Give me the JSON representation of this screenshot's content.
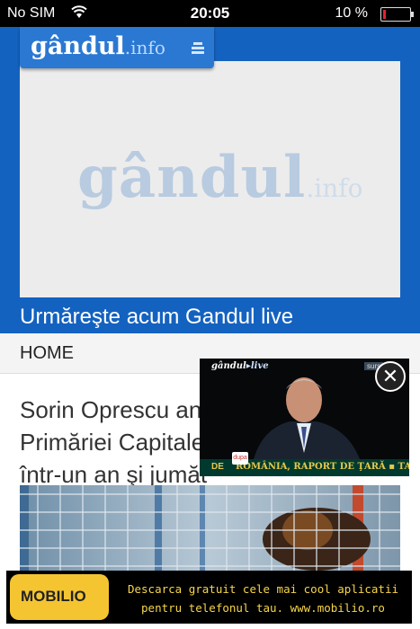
{
  "status": {
    "carrier": "No SIM",
    "time": "20:05",
    "battery_pct": "10 %",
    "battery_level": 0.1
  },
  "header": {
    "brand": "gândul",
    "brand_suffix": ".info",
    "menu_icon": "menu-icon"
  },
  "player": {
    "placeholder_brand": "gândul",
    "placeholder_suffix": ".info"
  },
  "live_cta": "Urmăreşte acum Gandul live",
  "nav": {
    "home": "HOME"
  },
  "article": {
    "headline_line1": "Sorin Oprescu anu",
    "headline_line2": "Primăriei Capitale",
    "headline_line3": "într-un an şi jumăt"
  },
  "live_overlay": {
    "logo": "gândul",
    "logo_suffix": "live",
    "source": "surs",
    "ticker_left": "DE",
    "ticker": "ROMÂNIA, RAPORT DE ŢARĂ",
    "ticker_right": "TAI",
    "channel_tag": "dupa"
  },
  "ad": {
    "logo": "MOBILIO",
    "line1": "Descarca gratuit cele mai cool aplicatii",
    "line2": "pentru telefonul tau. www.mobilio.ro"
  }
}
